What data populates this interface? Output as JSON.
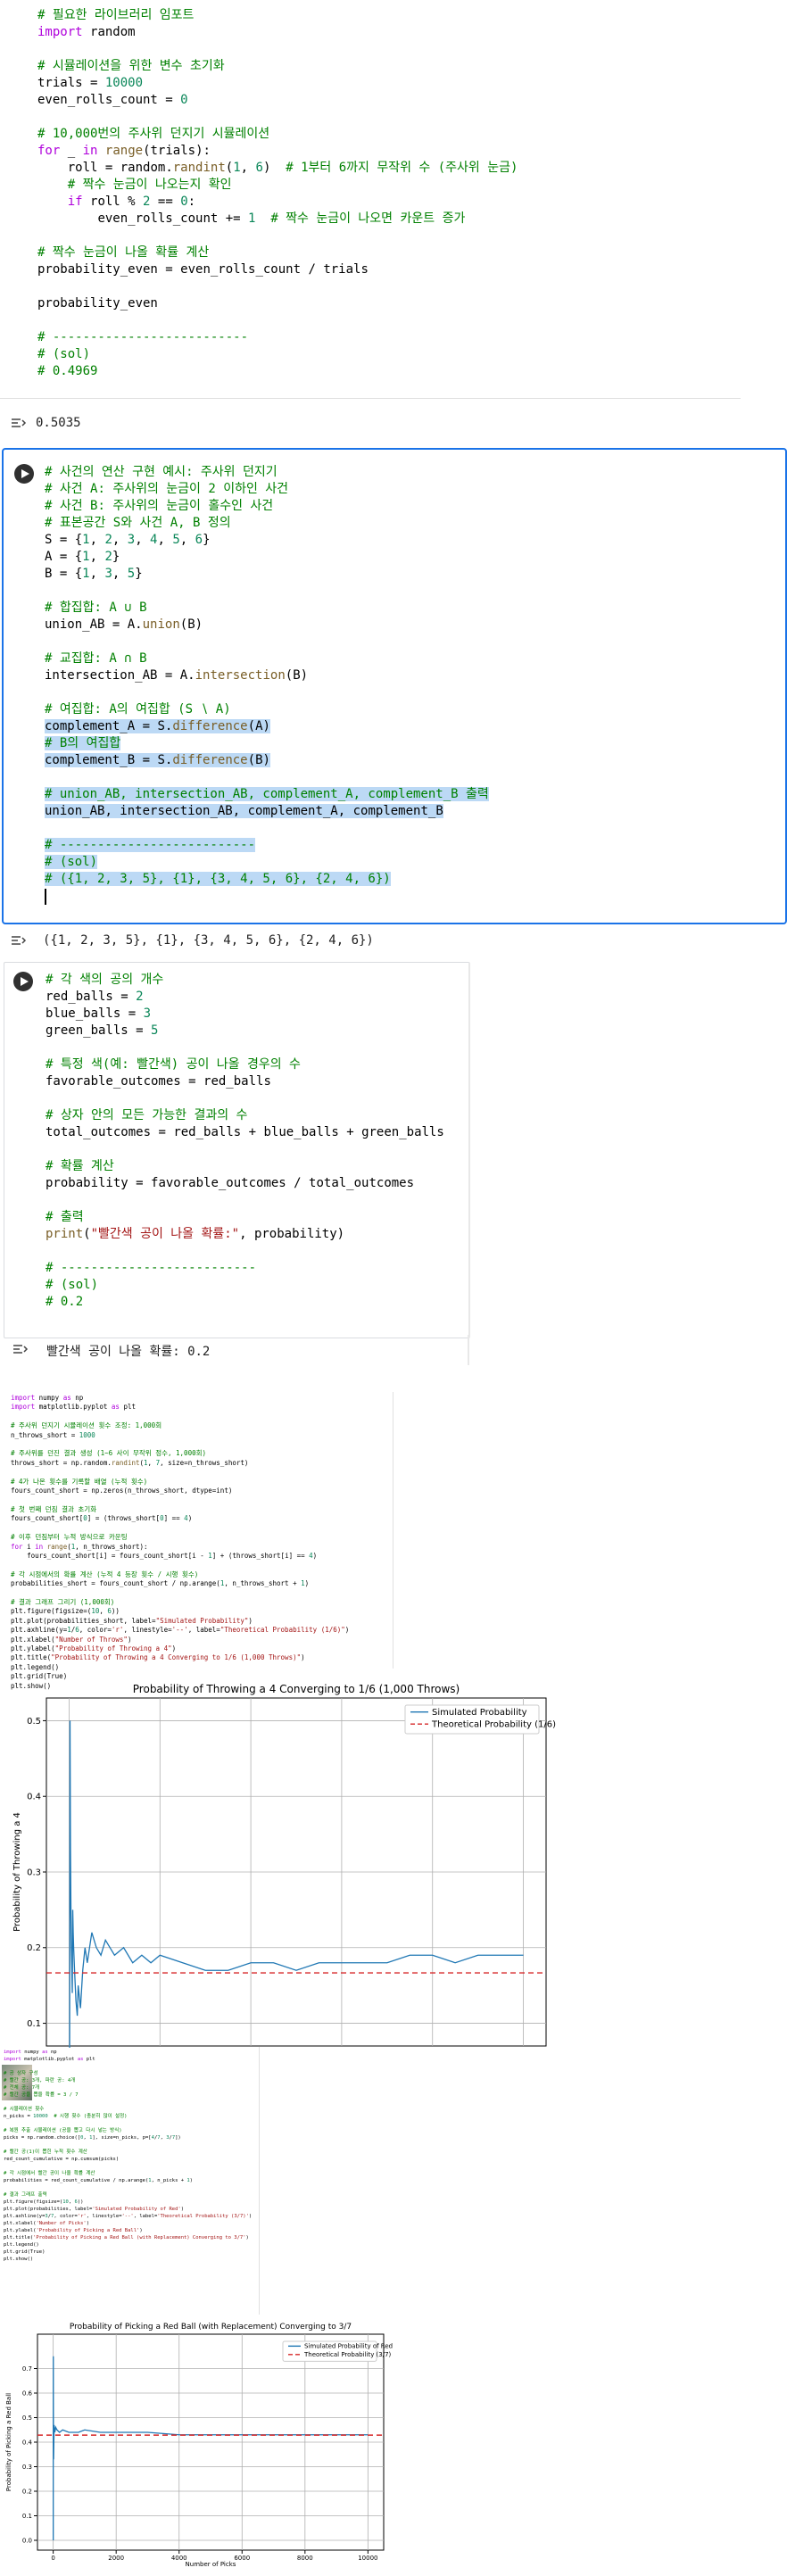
{
  "cell1": {
    "lines": [
      {
        "t": "# 필요한 라이브러리 임포트",
        "c": "cmt"
      },
      {
        "t": "import random",
        "c": "kwline"
      },
      {
        "t": "",
        "c": "plain"
      },
      {
        "t": "# 시뮬레이션을 위한 변수 초기화",
        "c": "cmt"
      },
      {
        "t": "trials = 10000",
        "c": "plain"
      },
      {
        "t": "even_rolls_count = 0",
        "c": "plain"
      },
      {
        "t": "",
        "c": "plain"
      },
      {
        "t": "# 10,000번의 주사위 던지기 시뮬레이션",
        "c": "cmt"
      },
      {
        "t": "for _ in range(trials):",
        "c": "kwline"
      },
      {
        "t": "    roll = random.randint(1, 6)  # 1부터 6까지 무작위 수 (주사위 눈금)",
        "c": "mixed"
      },
      {
        "t": "    # 짝수 눈금이 나오는지 확인",
        "c": "cmt"
      },
      {
        "t": "    if roll % 2 == 0:",
        "c": "kwline"
      },
      {
        "t": "        even_rolls_count += 1  # 짝수 눈금이 나오면 카운트 증가",
        "c": "mixed"
      },
      {
        "t": "",
        "c": "plain"
      },
      {
        "t": "# 짝수 눈금이 나올 확률 계산",
        "c": "cmt"
      },
      {
        "t": "probability_even = even_rolls_count / trials",
        "c": "plain"
      },
      {
        "t": "",
        "c": "plain"
      },
      {
        "t": "probability_even",
        "c": "plain"
      },
      {
        "t": "",
        "c": "plain"
      },
      {
        "t": "# --------------------------",
        "c": "cmt"
      },
      {
        "t": "# (sol)",
        "c": "cmt"
      },
      {
        "t": "# 0.4969",
        "c": "cmt"
      }
    ],
    "output": "0.5035"
  },
  "cell2": {
    "lines": [
      {
        "t": "# 사건의 연산 구현 예시: 주사위 던지기",
        "c": "cmt",
        "sel": false
      },
      {
        "t": "# 사건 A: 주사위의 눈금이 2 이하인 사건",
        "c": "cmt",
        "sel": false
      },
      {
        "t": "# 사건 B: 주사위의 눈금이 홀수인 사건",
        "c": "cmt",
        "sel": false
      },
      {
        "t": "# 표본공간 S와 사건 A, B 정의",
        "c": "cmt",
        "sel": false
      },
      {
        "t": "S = {1, 2, 3, 4, 5, 6}",
        "c": "plain",
        "sel": false
      },
      {
        "t": "A = {1, 2}",
        "c": "plain",
        "sel": false
      },
      {
        "t": "B = {1, 3, 5}",
        "c": "plain",
        "sel": false
      },
      {
        "t": "",
        "c": "plain",
        "sel": false
      },
      {
        "t": "# 합집합: A ∪ B",
        "c": "cmt",
        "sel": false
      },
      {
        "t": "union_AB = A.union(B)",
        "c": "plain",
        "sel": false
      },
      {
        "t": "",
        "c": "plain",
        "sel": false
      },
      {
        "t": "# 교집합: A ∩ B",
        "c": "cmt",
        "sel": false
      },
      {
        "t": "intersection_AB = A.intersection(B)",
        "c": "plain",
        "sel": false
      },
      {
        "t": "",
        "c": "plain",
        "sel": false
      },
      {
        "t": "# 여집합: A의 여집합 (S ∖ A)",
        "c": "cmt",
        "sel": false
      },
      {
        "t": "complement_A = S.difference(A)",
        "c": "plain",
        "sel": true
      },
      {
        "t": "# B의 여집합",
        "c": "cmt",
        "sel": true
      },
      {
        "t": "complement_B = S.difference(B)",
        "c": "plain",
        "sel": true
      },
      {
        "t": "",
        "c": "plain",
        "sel": false
      },
      {
        "t": "# union_AB, intersection_AB, complement_A, complement_B 출력",
        "c": "cmt",
        "sel": true
      },
      {
        "t": "union_AB, intersection_AB, complement_A, complement_B",
        "c": "plain",
        "sel": true
      },
      {
        "t": "",
        "c": "plain",
        "sel": false
      },
      {
        "t": "# --------------------------",
        "c": "cmt",
        "sel": true
      },
      {
        "t": "# (sol)",
        "c": "cmt",
        "sel": true
      },
      {
        "t": "# ({1, 2, 3, 5}, {1}, {3, 4, 5, 6}, {2, 4, 6})",
        "c": "cmt",
        "sel": true
      }
    ],
    "output": "({1, 2, 3, 5}, {1}, {3, 4, 5, 6}, {2, 4, 6})"
  },
  "cell3": {
    "lines": [
      {
        "t": "# 각 색의 공의 개수",
        "c": "cmt"
      },
      {
        "t": "red_balls = 2",
        "c": "plain"
      },
      {
        "t": "blue_balls = 3",
        "c": "plain"
      },
      {
        "t": "green_balls = 5",
        "c": "plain"
      },
      {
        "t": "",
        "c": "plain"
      },
      {
        "t": "# 특정 색(예: 빨간색) 공이 나올 경우의 수",
        "c": "cmt"
      },
      {
        "t": "favorable_outcomes = red_balls",
        "c": "plain"
      },
      {
        "t": "",
        "c": "plain"
      },
      {
        "t": "# 상자 안의 모든 가능한 결과의 수",
        "c": "cmt"
      },
      {
        "t": "total_outcomes = red_balls + blue_balls + green_balls",
        "c": "plain"
      },
      {
        "t": "",
        "c": "plain"
      },
      {
        "t": "# 확률 계산",
        "c": "cmt"
      },
      {
        "t": "probability = favorable_outcomes / total_outcomes",
        "c": "plain"
      },
      {
        "t": "",
        "c": "plain"
      },
      {
        "t": "# 출력",
        "c": "cmt"
      },
      {
        "t": "print(\"빨간색 공이 나올 확률:\", probability)",
        "c": "print"
      },
      {
        "t": "",
        "c": "plain"
      },
      {
        "t": "# --------------------------",
        "c": "cmt"
      },
      {
        "t": "# (sol)",
        "c": "cmt"
      },
      {
        "t": "# 0.2",
        "c": "cmt"
      }
    ],
    "output": "빨간색 공이 나올 확률: 0.2"
  },
  "cell4": {
    "lines": [
      {
        "t": "import numpy as np",
        "c": "kwline"
      },
      {
        "t": "import matplotlib.pyplot as plt",
        "c": "kwline"
      },
      {
        "t": "",
        "c": "plain"
      },
      {
        "t": "# 주사위 던지기 시뮬레이션 횟수 조정: 1,000회",
        "c": "cmt"
      },
      {
        "t": "n_throws_short = 1000",
        "c": "plain"
      },
      {
        "t": "",
        "c": "plain"
      },
      {
        "t": "# 주사위를 던진 결과 생성 (1~6 사이 무작위 정수, 1,000회)",
        "c": "cmt"
      },
      {
        "t": "throws_short = np.random.randint(1, 7, size=n_throws_short)",
        "c": "plain"
      },
      {
        "t": "",
        "c": "plain"
      },
      {
        "t": "# 4가 나온 횟수를 기록할 배열 (누적 횟수)",
        "c": "cmt"
      },
      {
        "t": "fours_count_short = np.zeros(n_throws_short, dtype=int)",
        "c": "plain"
      },
      {
        "t": "",
        "c": "plain"
      },
      {
        "t": "# 첫 번째 던짐 결과 초기화",
        "c": "cmt"
      },
      {
        "t": "fours_count_short[0] = (throws_short[0] == 4)",
        "c": "plain"
      },
      {
        "t": "",
        "c": "plain"
      },
      {
        "t": "# 이후 던짐부터 누적 방식으로 카운팅",
        "c": "cmt"
      },
      {
        "t": "for i in range(1, n_throws_short):",
        "c": "kwline"
      },
      {
        "t": "    fours_count_short[i] = fours_count_short[i - 1] + (throws_short[i] == 4)",
        "c": "plain"
      },
      {
        "t": "",
        "c": "plain"
      },
      {
        "t": "# 각 시점에서의 확률 계산 (누적 4 등장 횟수 / 시행 횟수)",
        "c": "cmt"
      },
      {
        "t": "probabilities_short = fours_count_short / np.arange(1, n_throws_short + 1)",
        "c": "plain"
      },
      {
        "t": "",
        "c": "plain"
      },
      {
        "t": "# 결과 그래프 그리기 (1,000회)",
        "c": "cmt"
      },
      {
        "t": "plt.figure(figsize=(10, 6))",
        "c": "plain"
      },
      {
        "t": "plt.plot(probabilities_short, label=\"Simulated Probability\")",
        "c": "plain"
      },
      {
        "t": "plt.axhline(y=1/6, color='r', linestyle='--', label=\"Theoretical Probability (1/6)\")",
        "c": "plain"
      },
      {
        "t": "plt.xlabel(\"Number of Throws\")",
        "c": "plain"
      },
      {
        "t": "plt.ylabel(\"Probability of Throwing a 4\")",
        "c": "plain"
      },
      {
        "t": "plt.title(\"Probability of Throwing a 4 Converging to 1/6 (1,000 Throws)\")",
        "c": "plain"
      },
      {
        "t": "plt.legend()",
        "c": "plain"
      },
      {
        "t": "plt.grid(True)",
        "c": "plain"
      },
      {
        "t": "plt.show()",
        "c": "plain"
      }
    ]
  },
  "cell5": {
    "lines": [
      {
        "t": "import numpy as np",
        "c": "kwline"
      },
      {
        "t": "import matplotlib.pyplot as plt",
        "c": "kwline"
      },
      {
        "t": "",
        "c": "plain"
      },
      {
        "t": "# 공 상자 구성",
        "c": "cmt"
      },
      {
        "t": "# 빨간 공: 3개, 파란 공: 4개",
        "c": "cmt"
      },
      {
        "t": "# 전체 공: 7개",
        "c": "cmt"
      },
      {
        "t": "# 빨간 공을 뽑을 확률 = 3 / 7",
        "c": "cmt"
      },
      {
        "t": "",
        "c": "plain"
      },
      {
        "t": "# 시뮬레이션 횟수",
        "c": "cmt"
      },
      {
        "t": "n_picks = 10000  # 시행 횟수 (충분히 많이 설정)",
        "c": "plain"
      },
      {
        "t": "",
        "c": "plain"
      },
      {
        "t": "# 복원 추출 시뮬레이션 (공을 뽑고 다시 넣는 방식)",
        "c": "cmt"
      },
      {
        "t": "picks = np.random.choice([0, 1], size=n_picks, p=[4/7, 3/7])",
        "c": "plain"
      },
      {
        "t": "",
        "c": "plain"
      },
      {
        "t": "# 빨간 공(1)이 뽑힌 누적 횟수 계산",
        "c": "cmt"
      },
      {
        "t": "red_count_cumulative = np.cumsum(picks)",
        "c": "plain"
      },
      {
        "t": "",
        "c": "plain"
      },
      {
        "t": "# 각 시점에서 빨간 공이 나올 확률 계산",
        "c": "cmt"
      },
      {
        "t": "probabilities = red_count_cumulative / np.arange(1, n_picks + 1)",
        "c": "plain"
      },
      {
        "t": "",
        "c": "plain"
      },
      {
        "t": "# 결과 그래프 출력",
        "c": "cmt"
      },
      {
        "t": "plt.figure(figsize=(10, 6))",
        "c": "plain"
      },
      {
        "t": "plt.plot(probabilities, label='Simulated Probability of Red')",
        "c": "plain"
      },
      {
        "t": "plt.axhline(y=3/7, color='r', linestyle='--', label='Theoretical Probability (3/7)')",
        "c": "plain"
      },
      {
        "t": "plt.xlabel('Number of Picks')",
        "c": "plain"
      },
      {
        "t": "plt.ylabel('Probability of Picking a Red Ball')",
        "c": "plain"
      },
      {
        "t": "plt.title('Probability of Picking a Red Ball (with Replacement) Converging to 3/7')",
        "c": "plain"
      },
      {
        "t": "plt.legend()",
        "c": "plain"
      },
      {
        "t": "plt.grid(True)",
        "c": "plain"
      },
      {
        "t": "plt.show()",
        "c": "plain"
      }
    ]
  },
  "chart_data": [
    {
      "type": "line",
      "title": "Probability of Throwing a 4 Converging to 1/6 (1,000 Throws)",
      "xlabel": "",
      "ylabel": "Probability of Throwing a 4",
      "ylim": [
        0.07,
        0.53
      ],
      "xlim": [
        -50,
        1050
      ],
      "yticks": [
        "0.1",
        "0.2",
        "0.3",
        "0.4",
        "0.5"
      ],
      "grid": true,
      "legend_position": "top-right",
      "series": [
        {
          "name": "Simulated Probability",
          "color": "#1f77b4",
          "x": [
            1,
            2,
            3,
            4,
            5,
            6,
            7,
            8,
            9,
            10,
            12,
            15,
            18,
            20,
            25,
            30,
            35,
            40,
            45,
            50,
            60,
            70,
            80,
            90,
            100,
            120,
            140,
            160,
            180,
            200,
            250,
            300,
            350,
            400,
            450,
            500,
            550,
            600,
            650,
            700,
            750,
            800,
            850,
            900,
            950,
            1000
          ],
          "y": [
            0.0,
            0.5,
            0.33,
            0.25,
            0.2,
            0.17,
            0.14,
            0.25,
            0.22,
            0.2,
            0.17,
            0.13,
            0.11,
            0.15,
            0.12,
            0.17,
            0.2,
            0.18,
            0.2,
            0.22,
            0.2,
            0.19,
            0.21,
            0.2,
            0.19,
            0.2,
            0.18,
            0.19,
            0.18,
            0.19,
            0.18,
            0.17,
            0.17,
            0.18,
            0.18,
            0.17,
            0.18,
            0.18,
            0.18,
            0.18,
            0.19,
            0.19,
            0.18,
            0.19,
            0.19,
            0.19
          ]
        },
        {
          "name": "Theoretical Probability (1/6)",
          "color": "#d62728",
          "y_const": 0.1667
        }
      ]
    },
    {
      "type": "line",
      "title": "Probability of Picking a Red Ball (with Replacement) Converging to 3/7",
      "xlabel": "Number of Picks",
      "ylabel": "Probability of Picking a Red Ball",
      "ylim": [
        -0.04,
        0.84
      ],
      "xlim": [
        -500,
        10500
      ],
      "xticks": [
        "0",
        "2000",
        "4000",
        "6000",
        "8000",
        "10000"
      ],
      "yticks": [
        "0.0",
        "0.1",
        "0.2",
        "0.3",
        "0.4",
        "0.5",
        "0.6",
        "0.7"
      ],
      "grid": true,
      "legend_position": "top-right",
      "series": [
        {
          "name": "Simulated Probability of Red",
          "color": "#1f77b4",
          "x": [
            1,
            2,
            3,
            4,
            5,
            8,
            12,
            20,
            30,
            50,
            80,
            120,
            200,
            300,
            500,
            800,
            1000,
            1500,
            2000,
            2500,
            3000,
            4000,
            5000,
            6000,
            7000,
            8000,
            9000,
            10000
          ],
          "y": [
            0.0,
            0.5,
            0.67,
            0.75,
            0.6,
            0.38,
            0.33,
            0.4,
            0.47,
            0.44,
            0.46,
            0.45,
            0.44,
            0.45,
            0.44,
            0.44,
            0.45,
            0.44,
            0.44,
            0.44,
            0.44,
            0.43,
            0.43,
            0.43,
            0.43,
            0.43,
            0.43,
            0.43
          ]
        },
        {
          "name": "Theoretical Probability (3/7)",
          "color": "#d62728",
          "y_const": 0.4286
        }
      ]
    }
  ]
}
